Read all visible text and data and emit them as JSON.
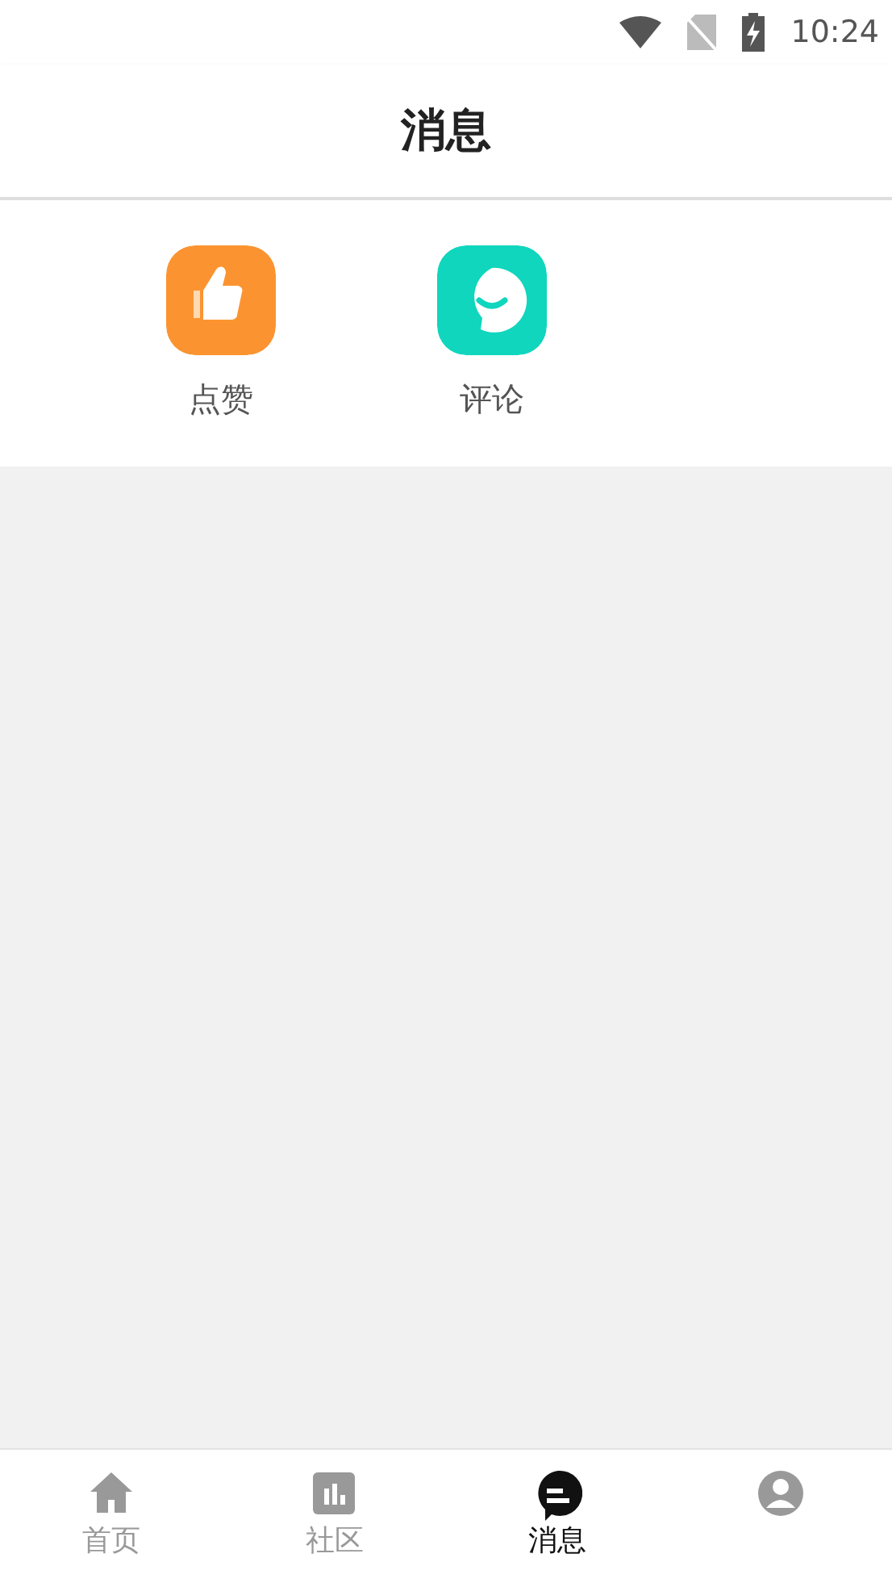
{
  "status_bar": {
    "time": "10:24"
  },
  "header": {
    "title": "消息"
  },
  "shortcuts": [
    {
      "kind": "like",
      "label": "点赞"
    },
    {
      "kind": "comment",
      "label": "评论"
    }
  ],
  "tab_bar": [
    {
      "kind": "home",
      "label": "首页",
      "selected": false
    },
    {
      "kind": "community",
      "label": "社区",
      "selected": false
    },
    {
      "kind": "messages",
      "label": "消息",
      "selected": true
    },
    {
      "kind": "profile",
      "selected": false
    }
  ]
}
